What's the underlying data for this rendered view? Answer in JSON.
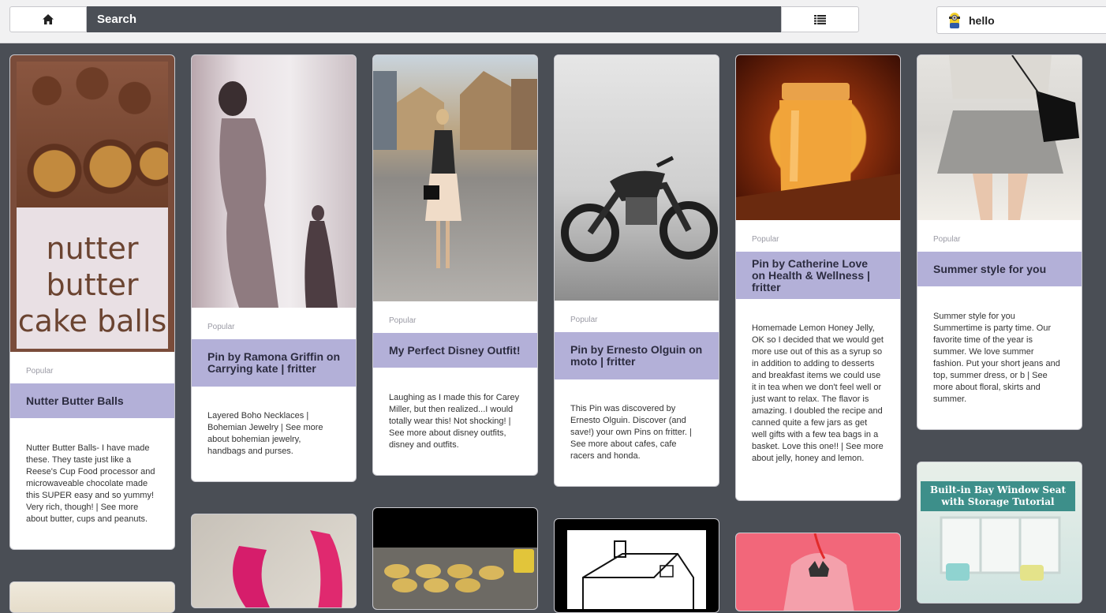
{
  "topbar": {
    "search_label": "Search",
    "user_name": "hello",
    "icons": {
      "home": "home-icon",
      "list": "list-icon",
      "avatar": "minion-avatar-icon"
    }
  },
  "colors": {
    "background": "#4a4e55",
    "title_band": "#b3b0d8",
    "search_bar": "#4b4f56"
  },
  "pins": [
    {
      "category": "Popular",
      "title": "Nutter Butter Balls",
      "description": "Nutter Butter Balls- I have made these. They taste just like a Reese's Cup Food processor and microwaveable chocolate made this SUPER easy and so yummy! Very rich, though! | See more about butter, cups and peanuts.",
      "image_text": [
        "nutter",
        "butter",
        "cake balls"
      ]
    },
    {
      "category": "Popular",
      "title": "Pin by Ramona Griffin on Carrying kate | fritter",
      "description": "Layered Boho Necklaces | Bohemian Jewelry | See more about bohemian jewelry, handbags and purses."
    },
    {
      "category": "Popular",
      "title": "My Perfect Disney Outfit!",
      "description": "Laughing as I made this for Carey Miller, but then realized...I would totally wear this! Not shocking! | See more about disney outfits, disney and outfits."
    },
    {
      "category": "Popular",
      "title": "Pin by Ernesto Olguin on moto | fritter",
      "description": "This Pin was discovered by Ernesto Olguin. Discover (and save!) your own Pins on fritter. | See more about cafes, cafe racers and honda."
    },
    {
      "category": "Popular",
      "title": "Pin by Catherine Love on Health & Wellness | fritter",
      "description": "Homemade Lemon Honey Jelly, OK so I decided that we would get more use out of this as a syrup so in addition to adding to desserts and breakfast items we could use it in tea when we don't feel well or just want to relax. The flavor is amazing. I doubled the recipe and canned quite a few jars as get well gifts with a few tea bags in a basket. Love this one!! | See more about jelly, honey and lemon."
    },
    {
      "category": "Popular",
      "title": "Summer style for you",
      "description": "Summer style for you Summertime is party time. Our favorite time of the year is summer. We love summer fashion. Put your short jeans and top, summer dress, or b | See more about floral, skirts and summer."
    }
  ],
  "partial_pins": [
    {
      "image_text": "Built-in Bay Window Seat with Storage Tutorial"
    }
  ]
}
